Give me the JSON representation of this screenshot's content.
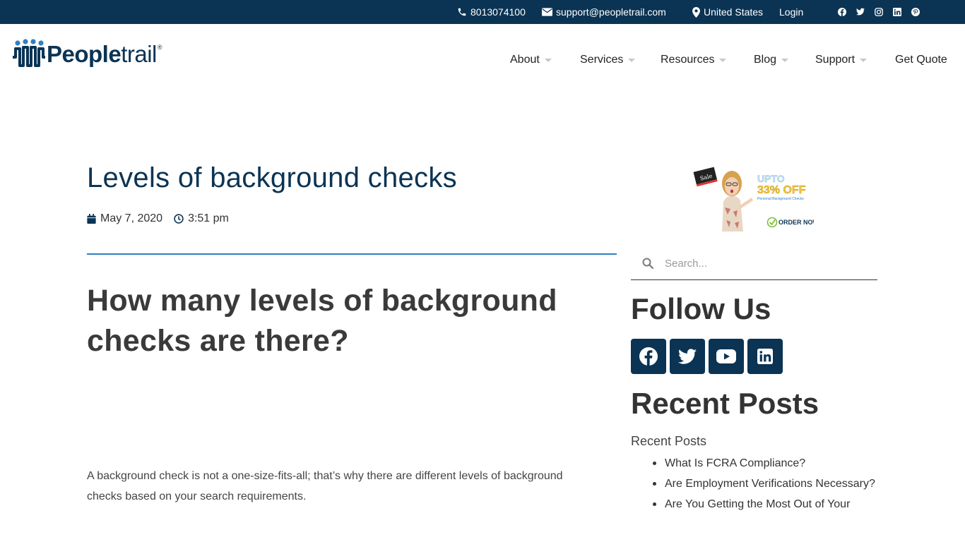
{
  "topbar": {
    "phone": "8013074100",
    "email": "support@peopletrail.com",
    "country": "United States",
    "login": "Login",
    "social_icons": [
      "facebook-icon",
      "twitter-icon",
      "instagram-icon",
      "linkedin-icon",
      "pinterest-icon"
    ]
  },
  "logo": {
    "bold": "People",
    "light": "trail",
    "reg": "®"
  },
  "nav": {
    "about": "About",
    "services": "Services",
    "resources": "Resources",
    "blog": "Blog",
    "support": "Support",
    "quote": "Get Quote"
  },
  "post": {
    "title": "Levels of background checks",
    "date": "May 7, 2020",
    "time": "3:51 pm",
    "heading": "How many levels of background checks are there?",
    "intro": "A background check is not a one-size-fits-all; that’s why there are different levels of background checks based on your search requirements."
  },
  "promo": {
    "badge": "Sale",
    "upto": "UPTO",
    "off": "33% OFF",
    "tagline": "Personal Background Checks",
    "order": "ORDER NOW"
  },
  "sidebar": {
    "search_placeholder": "Search...",
    "follow_title": "Follow Us",
    "follow_icons": [
      "facebook-icon",
      "twitter-icon",
      "youtube-icon",
      "linkedin-icon"
    ],
    "recent_title": "Recent Posts",
    "recent_subtitle": "Recent Posts",
    "recent_items": [
      "What Is FCRA Compliance?",
      "Are Employment Verifications Necessary?",
      "Are You Getting the Most Out of Your"
    ]
  },
  "colors": {
    "brand_navy": "#0b3454",
    "divider_blue": "#2f7fc1",
    "promo_green": "#7fbf3a"
  }
}
